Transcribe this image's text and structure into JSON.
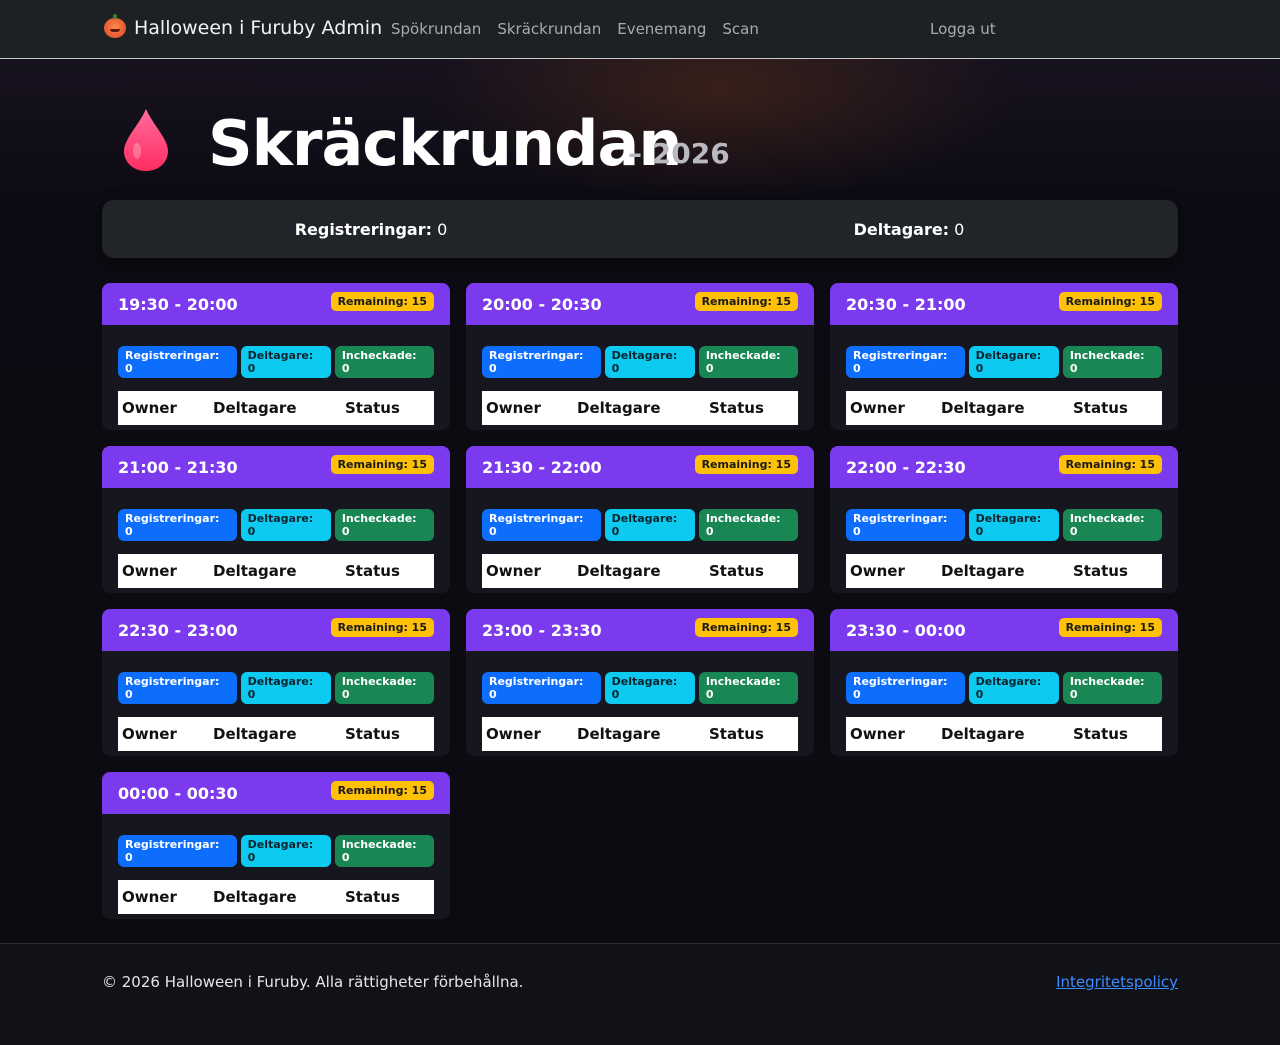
{
  "nav": {
    "brand": "Halloween i Furuby Admin",
    "links": [
      "Spökrundan",
      "Skräckrundan",
      "Evenemang",
      "Scan"
    ],
    "logout": "Logga ut"
  },
  "header": {
    "title": "Skräckrundan",
    "year": "– 2026",
    "icon": "blood-drop-icon"
  },
  "summary": {
    "registrations_label": "Registreringar:",
    "registrations_value": "0",
    "participants_label": "Deltagare:",
    "participants_value": "0"
  },
  "slots": [
    {
      "time": "19:30 - 20:00",
      "remaining": "Remaining: 15",
      "reg": "Registreringar: 0",
      "del": "Deltagare: 0",
      "inc": "Incheckade: 0"
    },
    {
      "time": "20:00 - 20:30",
      "remaining": "Remaining: 15",
      "reg": "Registreringar: 0",
      "del": "Deltagare: 0",
      "inc": "Incheckade: 0"
    },
    {
      "time": "20:30 - 21:00",
      "remaining": "Remaining: 15",
      "reg": "Registreringar: 0",
      "del": "Deltagare: 0",
      "inc": "Incheckade: 0"
    },
    {
      "time": "21:00 - 21:30",
      "remaining": "Remaining: 15",
      "reg": "Registreringar: 0",
      "del": "Deltagare: 0",
      "inc": "Incheckade: 0"
    },
    {
      "time": "21:30 - 22:00",
      "remaining": "Remaining: 15",
      "reg": "Registreringar: 0",
      "del": "Deltagare: 0",
      "inc": "Incheckade: 0"
    },
    {
      "time": "22:00 - 22:30",
      "remaining": "Remaining: 15",
      "reg": "Registreringar: 0",
      "del": "Deltagare: 0",
      "inc": "Incheckade: 0"
    },
    {
      "time": "22:30 - 23:00",
      "remaining": "Remaining: 15",
      "reg": "Registreringar: 0",
      "del": "Deltagare: 0",
      "inc": "Incheckade: 0"
    },
    {
      "time": "23:00 - 23:30",
      "remaining": "Remaining: 15",
      "reg": "Registreringar: 0",
      "del": "Deltagare: 0",
      "inc": "Incheckade: 0"
    },
    {
      "time": "23:30 - 00:00",
      "remaining": "Remaining: 15",
      "reg": "Registreringar: 0",
      "del": "Deltagare: 0",
      "inc": "Incheckade: 0"
    },
    {
      "time": "00:00 - 00:30",
      "remaining": "Remaining: 15",
      "reg": "Registreringar: 0",
      "del": "Deltagare: 0",
      "inc": "Incheckade: 0"
    }
  ],
  "table_headers": [
    "Owner",
    "Deltagare",
    "Status"
  ],
  "footer": {
    "copyright": "© 2026 Halloween i Furuby. Alla rättigheter förbehållna.",
    "privacy": "Integritetspolicy"
  },
  "colors": {
    "accent_purple": "#7b3aed",
    "remaining_yellow": "#ffc107",
    "badge_blue": "#0d6efd",
    "badge_cyan": "#0dcaf0",
    "badge_green": "#198754"
  }
}
